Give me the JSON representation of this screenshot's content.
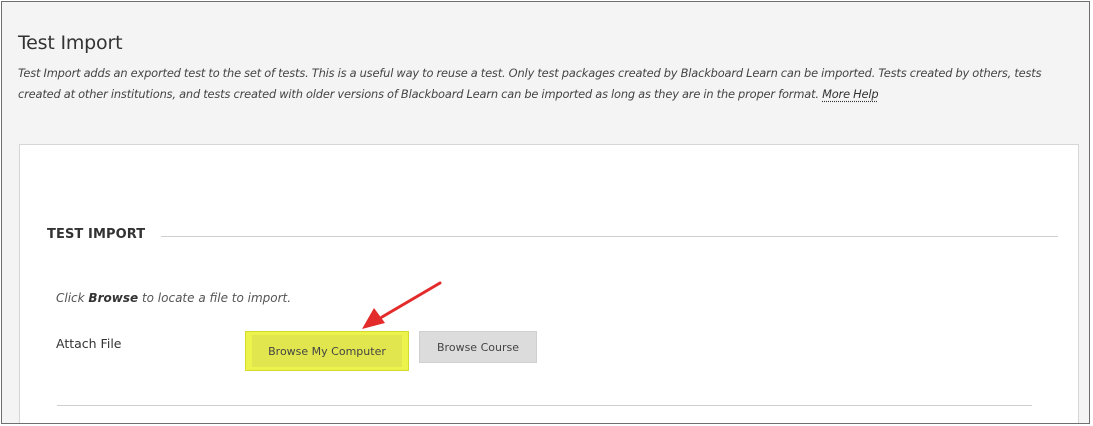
{
  "header": {
    "title": "Test Import",
    "description": "Test Import adds an exported test to the set of tests. This is a useful way to reuse a test. Only test packages created by Blackboard Learn can be imported. Tests created by others, tests created at other institutions, and tests created with older versions of Blackboard Learn can be imported as long as they are in the proper format.",
    "help_link": "More Help"
  },
  "section": {
    "title": "TEST IMPORT",
    "instruction_prefix": "Click",
    "instruction_bold": "Browse",
    "instruction_suffix": "to locate a file to import.",
    "field_label": "Attach File",
    "buttons": {
      "browse_computer": "Browse My Computer",
      "browse_course": "Browse Course"
    }
  },
  "colors": {
    "highlight": "#ecf34d",
    "arrow": "#e32b2b",
    "button_gray": "#dcdcdc"
  },
  "icons": {
    "annotation": "red-arrow"
  }
}
